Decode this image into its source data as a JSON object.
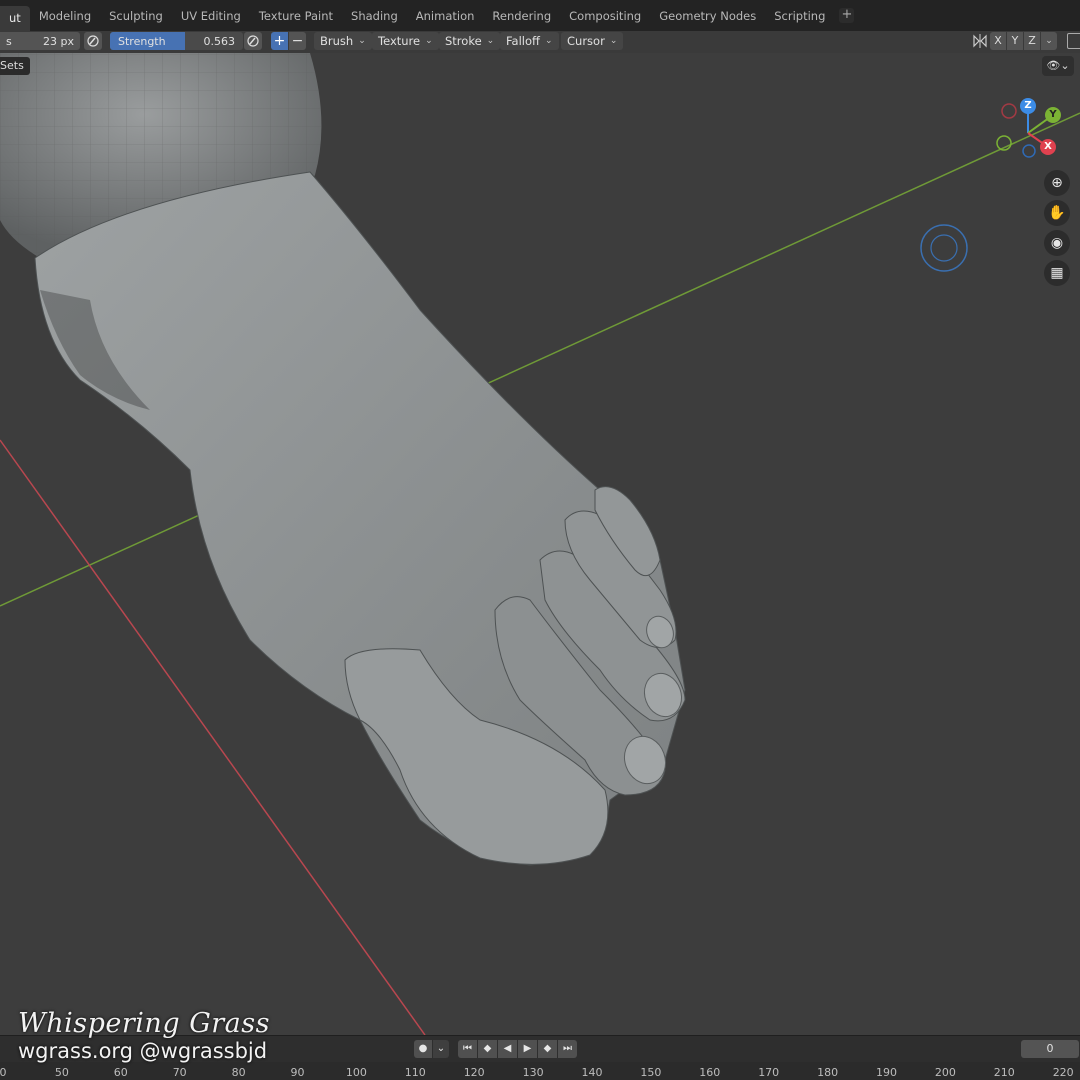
{
  "workspace_tabs": [
    {
      "label": "ut",
      "active": true
    },
    {
      "label": "Modeling",
      "active": false
    },
    {
      "label": "Sculpting",
      "active": false
    },
    {
      "label": "UV Editing",
      "active": false
    },
    {
      "label": "Texture Paint",
      "active": false
    },
    {
      "label": "Shading",
      "active": false
    },
    {
      "label": "Animation",
      "active": false
    },
    {
      "label": "Rendering",
      "active": false
    },
    {
      "label": "Compositing",
      "active": false
    },
    {
      "label": "Geometry Nodes",
      "active": false
    },
    {
      "label": "Scripting",
      "active": false
    }
  ],
  "add_workspace_label": "+",
  "tool_header": {
    "radius_label": "s",
    "radius_value": "23 px",
    "strength_label": "Strength",
    "strength_value": "0.563",
    "strength_fraction": 0.563,
    "direction_add": "+",
    "direction_subtract": "−",
    "menus": [
      "Brush",
      "Texture",
      "Stroke",
      "Falloff",
      "Cursor"
    ],
    "symmetry_axes": [
      "X",
      "Y",
      "Z"
    ]
  },
  "viewport": {
    "face_sets_label": "Sets",
    "gizmo_axes": {
      "x": "X",
      "y": "Y",
      "z": "Z"
    },
    "colors": {
      "x_axis": "#e0414f",
      "y_axis": "#7bb334",
      "z_axis": "#3c8ce6",
      "background": "#3d3d3d",
      "model": "#8a8e8f"
    }
  },
  "watermark": {
    "title": "Whispering Grass",
    "subtitle": "wgrass.org @wgrassbjd"
  },
  "timeline": {
    "current_frame": "0",
    "ruler_ticks": [
      "0",
      "50",
      "60",
      "70",
      "80",
      "90",
      "100",
      "110",
      "120",
      "130",
      "140",
      "150",
      "160",
      "170",
      "180",
      "190",
      "200",
      "210",
      "220"
    ]
  }
}
